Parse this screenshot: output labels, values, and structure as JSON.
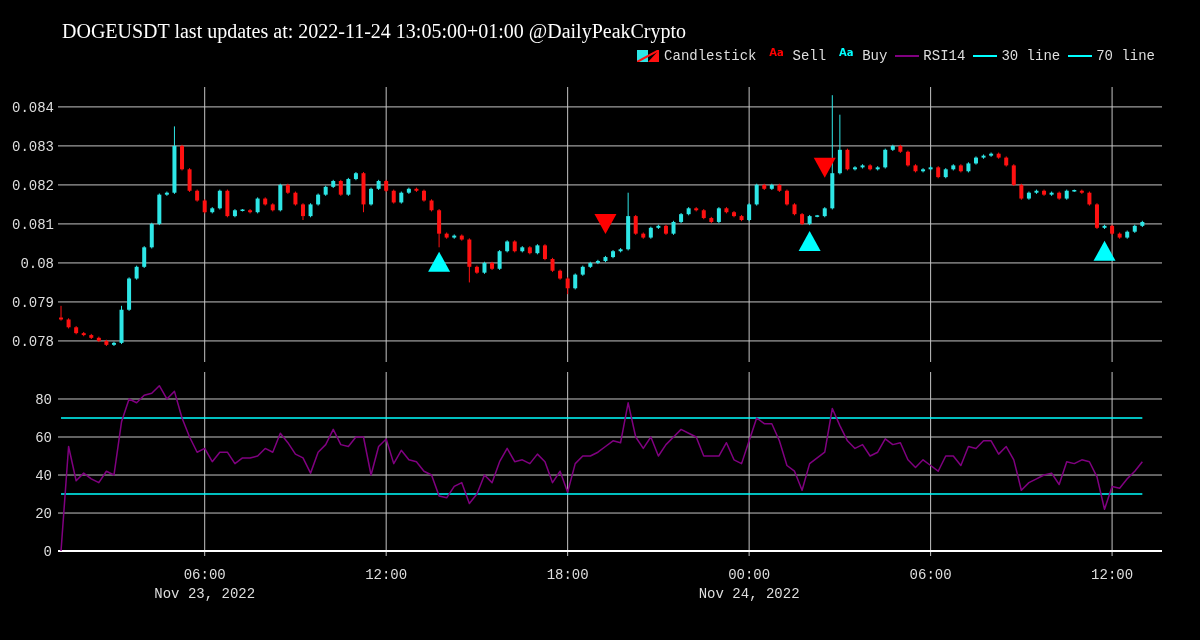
{
  "title": "DOGEUSDT last updates at: 2022-11-24 13:05:00+01:00 @DailyPeakCrypto",
  "legend": [
    {
      "label": "Candlestick",
      "kind": "candlestick"
    },
    {
      "label": "Sell",
      "kind": "text",
      "symbol": "Aa",
      "color": "#ff0000"
    },
    {
      "label": "Buy",
      "kind": "text",
      "symbol": "Aa",
      "color": "#00ffff"
    },
    {
      "label": "RSI14",
      "kind": "line",
      "color": "#800080"
    },
    {
      "label": "30 line",
      "kind": "line",
      "color": "#00ffff"
    },
    {
      "label": "70 line",
      "kind": "line",
      "color": "#00ffff"
    }
  ],
  "price_panel": {
    "chart_data": {
      "type": "candlestick",
      "grid": true,
      "x": [
        "2022-11-23 01:15",
        "2022-11-23 01:30",
        "2022-11-23 01:45",
        "2022-11-23 02:00",
        "2022-11-23 02:15",
        "2022-11-23 02:30",
        "2022-11-23 02:45",
        "2022-11-23 03:00",
        "2022-11-23 03:15",
        "2022-11-23 03:30",
        "2022-11-23 03:45",
        "2022-11-23 04:00",
        "2022-11-23 04:15",
        "2022-11-23 04:30",
        "2022-11-23 04:45",
        "2022-11-23 05:00",
        "2022-11-23 05:15",
        "2022-11-23 05:30",
        "2022-11-23 05:45",
        "2022-11-23 06:00",
        "2022-11-23 06:15",
        "2022-11-23 06:30",
        "2022-11-23 06:45",
        "2022-11-23 07:00",
        "2022-11-23 07:15",
        "2022-11-23 07:30",
        "2022-11-23 07:45",
        "2022-11-23 08:00",
        "2022-11-23 08:15",
        "2022-11-23 08:30",
        "2022-11-23 08:45",
        "2022-11-23 09:00",
        "2022-11-23 09:15",
        "2022-11-23 09:30",
        "2022-11-23 09:45",
        "2022-11-23 10:00",
        "2022-11-23 10:15",
        "2022-11-23 10:30",
        "2022-11-23 10:45",
        "2022-11-23 11:00",
        "2022-11-23 11:15",
        "2022-11-23 11:30",
        "2022-11-23 11:45",
        "2022-11-23 12:00",
        "2022-11-23 12:15",
        "2022-11-23 12:30",
        "2022-11-23 12:45",
        "2022-11-23 13:00",
        "2022-11-23 13:15",
        "2022-11-23 13:30",
        "2022-11-23 13:45",
        "2022-11-23 14:00",
        "2022-11-23 14:15",
        "2022-11-23 14:30",
        "2022-11-23 14:45",
        "2022-11-23 15:00",
        "2022-11-23 15:15",
        "2022-11-23 15:30",
        "2022-11-23 15:45",
        "2022-11-23 16:00",
        "2022-11-23 16:15",
        "2022-11-23 16:30",
        "2022-11-23 16:45",
        "2022-11-23 17:00",
        "2022-11-23 17:15",
        "2022-11-23 17:30",
        "2022-11-23 17:45",
        "2022-11-23 18:00",
        "2022-11-23 18:15",
        "2022-11-23 18:30",
        "2022-11-23 18:45",
        "2022-11-23 19:00",
        "2022-11-23 19:15",
        "2022-11-23 19:30",
        "2022-11-23 19:45",
        "2022-11-23 20:00",
        "2022-11-23 20:15",
        "2022-11-23 20:30",
        "2022-11-23 20:45",
        "2022-11-23 21:00",
        "2022-11-23 21:15",
        "2022-11-23 21:30",
        "2022-11-23 21:45",
        "2022-11-23 22:00",
        "2022-11-23 22:15",
        "2022-11-23 22:30",
        "2022-11-23 22:45",
        "2022-11-23 23:00",
        "2022-11-23 23:15",
        "2022-11-23 23:30",
        "2022-11-23 23:45",
        "2022-11-24 00:00",
        "2022-11-24 00:15",
        "2022-11-24 00:30",
        "2022-11-24 00:45",
        "2022-11-24 01:00",
        "2022-11-24 01:15",
        "2022-11-24 01:30",
        "2022-11-24 01:45",
        "2022-11-24 02:00",
        "2022-11-24 02:15",
        "2022-11-24 02:30",
        "2022-11-24 02:45",
        "2022-11-24 03:00",
        "2022-11-24 03:15",
        "2022-11-24 03:30",
        "2022-11-24 03:45",
        "2022-11-24 04:00",
        "2022-11-24 04:15",
        "2022-11-24 04:30",
        "2022-11-24 04:45",
        "2022-11-24 05:00",
        "2022-11-24 05:15",
        "2022-11-24 05:30",
        "2022-11-24 05:45",
        "2022-11-24 06:00",
        "2022-11-24 06:15",
        "2022-11-24 06:30",
        "2022-11-24 06:45",
        "2022-11-24 07:00",
        "2022-11-24 07:15",
        "2022-11-24 07:30",
        "2022-11-24 07:45",
        "2022-11-24 08:00",
        "2022-11-24 08:15",
        "2022-11-24 08:30",
        "2022-11-24 08:45",
        "2022-11-24 09:00",
        "2022-11-24 09:15",
        "2022-11-24 09:30",
        "2022-11-24 09:45",
        "2022-11-24 10:00",
        "2022-11-24 10:15",
        "2022-11-24 10:30",
        "2022-11-24 10:45",
        "2022-11-24 11:00",
        "2022-11-24 11:15",
        "2022-11-24 11:30",
        "2022-11-24 11:45",
        "2022-11-24 12:00",
        "2022-11-24 12:15",
        "2022-11-24 12:30",
        "2022-11-24 12:45",
        "2022-11-24 13:00"
      ],
      "xlim": [
        "2022-11-23 01:09",
        "2022-11-24 13:39"
      ],
      "ylim": [
        0.07746,
        0.08451
      ],
      "yticks": [
        {
          "value": 0.078,
          "label": "0.078"
        },
        {
          "value": 0.079,
          "label": "0.079"
        },
        {
          "value": 0.08,
          "label": "0.08"
        },
        {
          "value": 0.081,
          "label": "0.081"
        },
        {
          "value": 0.082,
          "label": "0.082"
        },
        {
          "value": 0.083,
          "label": "0.083"
        },
        {
          "value": 0.084,
          "label": "0.084"
        }
      ],
      "ohlc": [
        [
          0.0786,
          0.0789,
          0.07852,
          0.07855
        ],
        [
          0.07855,
          0.07858,
          0.07832,
          0.07835
        ],
        [
          0.07835,
          0.07838,
          0.07817,
          0.0782
        ],
        [
          0.0782,
          0.07823,
          0.07812,
          0.07815
        ],
        [
          0.07815,
          0.07818,
          0.07805,
          0.07808
        ],
        [
          0.07808,
          0.07811,
          0.07797,
          0.078
        ],
        [
          0.078,
          0.07803,
          0.07787,
          0.0779
        ],
        [
          0.0779,
          0.07798,
          0.07787,
          0.07795
        ],
        [
          0.07795,
          0.0789,
          0.07792,
          0.0788
        ],
        [
          0.0788,
          0.07963,
          0.07877,
          0.0796
        ],
        [
          0.0796,
          0.07993,
          0.07957,
          0.0799
        ],
        [
          0.0799,
          0.08043,
          0.07987,
          0.0804
        ],
        [
          0.0804,
          0.08103,
          0.08037,
          0.081
        ],
        [
          0.081,
          0.08178,
          0.08097,
          0.08175
        ],
        [
          0.08175,
          0.08183,
          0.08172,
          0.0818
        ],
        [
          0.0818,
          0.0835,
          0.08177,
          0.083
        ],
        [
          0.083,
          0.08303,
          0.08237,
          0.0824
        ],
        [
          0.0824,
          0.08243,
          0.08182,
          0.08185
        ],
        [
          0.08185,
          0.08188,
          0.08157,
          0.0816
        ],
        [
          0.0816,
          0.08163,
          0.08127,
          0.0813
        ],
        [
          0.0813,
          0.08143,
          0.08127,
          0.0814
        ],
        [
          0.0814,
          0.08188,
          0.08137,
          0.08185
        ],
        [
          0.08185,
          0.08188,
          0.08117,
          0.0812
        ],
        [
          0.0812,
          0.08138,
          0.08117,
          0.08135
        ],
        [
          0.08135,
          0.08138,
          0.08132,
          0.08135
        ],
        [
          0.08135,
          0.08138,
          0.08127,
          0.0813
        ],
        [
          0.0813,
          0.08168,
          0.08127,
          0.08165
        ],
        [
          0.08165,
          0.08168,
          0.08147,
          0.0815
        ],
        [
          0.0815,
          0.08153,
          0.08132,
          0.08135
        ],
        [
          0.08135,
          0.08203,
          0.08132,
          0.082
        ],
        [
          0.082,
          0.08203,
          0.08177,
          0.0818
        ],
        [
          0.0818,
          0.08183,
          0.08147,
          0.0815
        ],
        [
          0.0815,
          0.08153,
          0.0811,
          0.0812
        ],
        [
          0.0812,
          0.08153,
          0.08117,
          0.0815
        ],
        [
          0.0815,
          0.08178,
          0.08147,
          0.08175
        ],
        [
          0.08175,
          0.08198,
          0.08172,
          0.08195
        ],
        [
          0.08195,
          0.08213,
          0.08192,
          0.0821
        ],
        [
          0.0821,
          0.08213,
          0.08172,
          0.08175
        ],
        [
          0.08175,
          0.08218,
          0.08172,
          0.08215
        ],
        [
          0.08215,
          0.08233,
          0.08212,
          0.0823
        ],
        [
          0.0823,
          0.08233,
          0.0813,
          0.0815
        ],
        [
          0.0815,
          0.08193,
          0.08147,
          0.0819
        ],
        [
          0.0819,
          0.08213,
          0.08187,
          0.0821
        ],
        [
          0.0821,
          0.08213,
          0.08182,
          0.08185
        ],
        [
          0.08185,
          0.08188,
          0.08152,
          0.08155
        ],
        [
          0.08155,
          0.08183,
          0.08152,
          0.0818
        ],
        [
          0.0818,
          0.08193,
          0.08177,
          0.0819
        ],
        [
          0.0819,
          0.08193,
          0.08182,
          0.08185
        ],
        [
          0.08185,
          0.08188,
          0.08157,
          0.0816
        ],
        [
          0.0816,
          0.08163,
          0.08132,
          0.08135
        ],
        [
          0.08135,
          0.08138,
          0.0804,
          0.08075
        ],
        [
          0.08075,
          0.08078,
          0.08062,
          0.08065
        ],
        [
          0.08065,
          0.08073,
          0.08062,
          0.0807
        ],
        [
          0.0807,
          0.08073,
          0.08057,
          0.0806
        ],
        [
          0.0806,
          0.08063,
          0.0795,
          0.0799
        ],
        [
          0.0799,
          0.07993,
          0.07972,
          0.07975
        ],
        [
          0.07975,
          0.08003,
          0.07972,
          0.08
        ],
        [
          0.08,
          0.08003,
          0.07982,
          0.07985
        ],
        [
          0.07985,
          0.08033,
          0.07982,
          0.0803
        ],
        [
          0.0803,
          0.08058,
          0.08027,
          0.08055
        ],
        [
          0.08055,
          0.08058,
          0.08027,
          0.0803
        ],
        [
          0.0803,
          0.08043,
          0.08027,
          0.0804
        ],
        [
          0.0804,
          0.08043,
          0.08022,
          0.08025
        ],
        [
          0.08025,
          0.08048,
          0.08022,
          0.08045
        ],
        [
          0.08045,
          0.08048,
          0.08007,
          0.0801
        ],
        [
          0.0801,
          0.08013,
          0.07977,
          0.0798
        ],
        [
          0.0798,
          0.07983,
          0.07957,
          0.0796
        ],
        [
          0.0796,
          0.07963,
          0.0792,
          0.07935
        ],
        [
          0.07935,
          0.07973,
          0.07932,
          0.0797
        ],
        [
          0.0797,
          0.07993,
          0.07967,
          0.0799
        ],
        [
          0.0799,
          0.08003,
          0.07987,
          0.08
        ],
        [
          0.08,
          0.08008,
          0.07997,
          0.08005
        ],
        [
          0.08005,
          0.08018,
          0.08002,
          0.08015
        ],
        [
          0.08015,
          0.08033,
          0.08012,
          0.0803
        ],
        [
          0.0803,
          0.08038,
          0.08027,
          0.08035
        ],
        [
          0.08035,
          0.0818,
          0.08032,
          0.0812
        ],
        [
          0.0812,
          0.08123,
          0.08072,
          0.08075
        ],
        [
          0.08075,
          0.08078,
          0.08062,
          0.08065
        ],
        [
          0.08065,
          0.08093,
          0.08062,
          0.0809
        ],
        [
          0.0809,
          0.08098,
          0.08087,
          0.08095
        ],
        [
          0.08095,
          0.08098,
          0.08072,
          0.08075
        ],
        [
          0.08075,
          0.08108,
          0.08072,
          0.08105
        ],
        [
          0.08105,
          0.08128,
          0.08102,
          0.08125
        ],
        [
          0.08125,
          0.08143,
          0.08122,
          0.0814
        ],
        [
          0.0814,
          0.08143,
          0.08132,
          0.08135
        ],
        [
          0.08135,
          0.08138,
          0.08112,
          0.08115
        ],
        [
          0.08115,
          0.08118,
          0.08102,
          0.08105
        ],
        [
          0.08105,
          0.08143,
          0.08102,
          0.0814
        ],
        [
          0.0814,
          0.08143,
          0.08127,
          0.0813
        ],
        [
          0.0813,
          0.08133,
          0.08117,
          0.0812
        ],
        [
          0.0812,
          0.08123,
          0.08107,
          0.0811
        ],
        [
          0.0811,
          0.08153,
          0.08107,
          0.0815
        ],
        [
          0.0815,
          0.08203,
          0.08147,
          0.082
        ],
        [
          0.082,
          0.08203,
          0.08187,
          0.0819
        ],
        [
          0.0819,
          0.08203,
          0.08187,
          0.082
        ],
        [
          0.082,
          0.08203,
          0.08182,
          0.08185
        ],
        [
          0.08185,
          0.08188,
          0.08147,
          0.0815
        ],
        [
          0.0815,
          0.08153,
          0.08122,
          0.08125
        ],
        [
          0.08125,
          0.08128,
          0.08097,
          0.081
        ],
        [
          0.081,
          0.08123,
          0.08097,
          0.0812
        ],
        [
          0.0812,
          0.08123,
          0.08117,
          0.0812
        ],
        [
          0.0812,
          0.08143,
          0.08117,
          0.0814
        ],
        [
          0.0814,
          0.0843,
          0.08137,
          0.0823
        ],
        [
          0.0823,
          0.0838,
          0.08227,
          0.0829
        ],
        [
          0.0829,
          0.08293,
          0.08237,
          0.0824
        ],
        [
          0.0824,
          0.08248,
          0.08237,
          0.08245
        ],
        [
          0.08245,
          0.08253,
          0.08242,
          0.0825
        ],
        [
          0.0825,
          0.08253,
          0.08237,
          0.0824
        ],
        [
          0.0824,
          0.08248,
          0.08237,
          0.08245
        ],
        [
          0.08245,
          0.08293,
          0.08242,
          0.0829
        ],
        [
          0.0829,
          0.08303,
          0.08287,
          0.083
        ],
        [
          0.083,
          0.08303,
          0.08282,
          0.08285
        ],
        [
          0.08285,
          0.08288,
          0.08247,
          0.0825
        ],
        [
          0.0825,
          0.08253,
          0.08232,
          0.08235
        ],
        [
          0.08235,
          0.08243,
          0.08232,
          0.0824
        ],
        [
          0.0824,
          0.08248,
          0.08237,
          0.08245
        ],
        [
          0.08245,
          0.08248,
          0.08217,
          0.0822
        ],
        [
          0.0822,
          0.08243,
          0.08217,
          0.0824
        ],
        [
          0.0824,
          0.08253,
          0.08237,
          0.0825
        ],
        [
          0.0825,
          0.08253,
          0.08232,
          0.08235
        ],
        [
          0.08235,
          0.08258,
          0.08232,
          0.08255
        ],
        [
          0.08255,
          0.08273,
          0.08252,
          0.0827
        ],
        [
          0.0827,
          0.08278,
          0.08267,
          0.08275
        ],
        [
          0.08275,
          0.08283,
          0.08272,
          0.0828
        ],
        [
          0.0828,
          0.08283,
          0.08267,
          0.0827
        ],
        [
          0.0827,
          0.08273,
          0.08247,
          0.0825
        ],
        [
          0.0825,
          0.08253,
          0.08197,
          0.082
        ],
        [
          0.082,
          0.08203,
          0.08162,
          0.08165
        ],
        [
          0.08165,
          0.08183,
          0.08162,
          0.0818
        ],
        [
          0.0818,
          0.08188,
          0.08177,
          0.08185
        ],
        [
          0.08185,
          0.08188,
          0.08172,
          0.08175
        ],
        [
          0.08175,
          0.08183,
          0.08172,
          0.0818
        ],
        [
          0.0818,
          0.08183,
          0.08162,
          0.08165
        ],
        [
          0.08165,
          0.08188,
          0.08162,
          0.08185
        ],
        [
          0.08185,
          0.08188,
          0.08182,
          0.08185
        ],
        [
          0.08185,
          0.08188,
          0.08177,
          0.0818
        ],
        [
          0.0818,
          0.08183,
          0.08147,
          0.0815
        ],
        [
          0.0815,
          0.08153,
          0.08087,
          0.0809
        ],
        [
          0.0809,
          0.08098,
          0.08087,
          0.08095
        ],
        [
          0.08095,
          0.08098,
          0.08072,
          0.08075
        ],
        [
          0.08075,
          0.08078,
          0.08062,
          0.08065
        ],
        [
          0.08065,
          0.08083,
          0.08062,
          0.0808
        ],
        [
          0.0808,
          0.08098,
          0.08077,
          0.08095
        ],
        [
          0.08095,
          0.08108,
          0.08092,
          0.08105
        ]
      ],
      "series": [
        {
          "type": "scatter",
          "marker": "triangle-down",
          "color": "#ff0000",
          "values": [
            null,
            null,
            null,
            null,
            null,
            null,
            null,
            null,
            null,
            null,
            null,
            null,
            null,
            null,
            null,
            null,
            null,
            null,
            null,
            null,
            null,
            null,
            null,
            null,
            null,
            null,
            null,
            null,
            null,
            null,
            null,
            null,
            null,
            null,
            null,
            null,
            null,
            null,
            null,
            null,
            null,
            null,
            null,
            null,
            null,
            null,
            null,
            null,
            null,
            null,
            null,
            null,
            null,
            null,
            null,
            null,
            null,
            null,
            null,
            null,
            null,
            null,
            null,
            null,
            null,
            null,
            null,
            null,
            null,
            null,
            null,
            null,
            0.081,
            null,
            null,
            null,
            null,
            null,
            null,
            null,
            null,
            null,
            null,
            null,
            null,
            null,
            null,
            null,
            null,
            null,
            null,
            null,
            null,
            null,
            null,
            null,
            null,
            null,
            null,
            null,
            null,
            0.08244,
            null,
            null,
            null,
            null,
            null,
            null,
            null,
            null,
            null,
            null,
            null,
            null,
            null,
            null,
            null,
            null,
            null,
            null,
            null,
            null,
            null,
            null,
            null,
            null,
            null,
            null,
            null,
            null,
            null,
            null,
            null,
            null,
            null,
            null,
            null,
            null,
            null,
            null,
            null,
            null,
            null,
            null
          ]
        },
        {
          "type": "scatter",
          "marker": "triangle-up",
          "color": "#00ffff",
          "values": [
            null,
            null,
            null,
            null,
            null,
            null,
            null,
            null,
            null,
            null,
            null,
            null,
            null,
            null,
            null,
            null,
            null,
            null,
            null,
            null,
            null,
            null,
            null,
            null,
            null,
            null,
            null,
            null,
            null,
            null,
            null,
            null,
            null,
            null,
            null,
            null,
            null,
            null,
            null,
            null,
            null,
            null,
            null,
            null,
            null,
            null,
            null,
            null,
            null,
            null,
            0.08003,
            null,
            null,
            null,
            null,
            null,
            null,
            null,
            null,
            null,
            null,
            null,
            null,
            null,
            null,
            null,
            null,
            null,
            null,
            null,
            null,
            null,
            null,
            null,
            null,
            null,
            null,
            null,
            null,
            null,
            null,
            null,
            null,
            null,
            null,
            null,
            null,
            null,
            null,
            null,
            null,
            null,
            null,
            null,
            null,
            null,
            null,
            null,
            null,
            0.08056,
            null,
            null,
            null,
            null,
            null,
            null,
            null,
            null,
            null,
            null,
            null,
            null,
            null,
            null,
            null,
            null,
            null,
            null,
            null,
            null,
            null,
            null,
            null,
            null,
            null,
            null,
            null,
            null,
            null,
            null,
            null,
            null,
            null,
            null,
            null,
            null,
            null,
            null,
            0.08031,
            null,
            null,
            null,
            null,
            null
          ]
        }
      ]
    }
  },
  "rsi_panel": {
    "chart_data": {
      "type": "line",
      "grid": true,
      "x": [
        "2022-11-23 01:15",
        "2022-11-23 01:30",
        "2022-11-23 01:45",
        "2022-11-23 02:00",
        "2022-11-23 02:15",
        "2022-11-23 02:30",
        "2022-11-23 02:45",
        "2022-11-23 03:00",
        "2022-11-23 03:15",
        "2022-11-23 03:30",
        "2022-11-23 03:45",
        "2022-11-23 04:00",
        "2022-11-23 04:15",
        "2022-11-23 04:30",
        "2022-11-23 04:45",
        "2022-11-23 05:00",
        "2022-11-23 05:15",
        "2022-11-23 05:30",
        "2022-11-23 05:45",
        "2022-11-23 06:00",
        "2022-11-23 06:15",
        "2022-11-23 06:30",
        "2022-11-23 06:45",
        "2022-11-23 07:00",
        "2022-11-23 07:15",
        "2022-11-23 07:30",
        "2022-11-23 07:45",
        "2022-11-23 08:00",
        "2022-11-23 08:15",
        "2022-11-23 08:30",
        "2022-11-23 08:45",
        "2022-11-23 09:00",
        "2022-11-23 09:15",
        "2022-11-23 09:30",
        "2022-11-23 09:45",
        "2022-11-23 10:00",
        "2022-11-23 10:15",
        "2022-11-23 10:30",
        "2022-11-23 10:45",
        "2022-11-23 11:00",
        "2022-11-23 11:15",
        "2022-11-23 11:30",
        "2022-11-23 11:45",
        "2022-11-23 12:00",
        "2022-11-23 12:15",
        "2022-11-23 12:30",
        "2022-11-23 12:45",
        "2022-11-23 13:00",
        "2022-11-23 13:15",
        "2022-11-23 13:30",
        "2022-11-23 13:45",
        "2022-11-23 14:00",
        "2022-11-23 14:15",
        "2022-11-23 14:30",
        "2022-11-23 14:45",
        "2022-11-23 15:00",
        "2022-11-23 15:15",
        "2022-11-23 15:30",
        "2022-11-23 15:45",
        "2022-11-23 16:00",
        "2022-11-23 16:15",
        "2022-11-23 16:30",
        "2022-11-23 16:45",
        "2022-11-23 17:00",
        "2022-11-23 17:15",
        "2022-11-23 17:30",
        "2022-11-23 17:45",
        "2022-11-23 18:00",
        "2022-11-23 18:15",
        "2022-11-23 18:30",
        "2022-11-23 18:45",
        "2022-11-23 19:00",
        "2022-11-23 19:15",
        "2022-11-23 19:30",
        "2022-11-23 19:45",
        "2022-11-23 20:00",
        "2022-11-23 20:15",
        "2022-11-23 20:30",
        "2022-11-23 20:45",
        "2022-11-23 21:00",
        "2022-11-23 21:15",
        "2022-11-23 21:30",
        "2022-11-23 21:45",
        "2022-11-23 22:00",
        "2022-11-23 22:15",
        "2022-11-23 22:30",
        "2022-11-23 22:45",
        "2022-11-23 23:00",
        "2022-11-23 23:15",
        "2022-11-23 23:30",
        "2022-11-23 23:45",
        "2022-11-24 00:00",
        "2022-11-24 00:15",
        "2022-11-24 00:30",
        "2022-11-24 00:45",
        "2022-11-24 01:00",
        "2022-11-24 01:15",
        "2022-11-24 01:30",
        "2022-11-24 01:45",
        "2022-11-24 02:00",
        "2022-11-24 02:15",
        "2022-11-24 02:30",
        "2022-11-24 02:45",
        "2022-11-24 03:00",
        "2022-11-24 03:15",
        "2022-11-24 03:30",
        "2022-11-24 03:45",
        "2022-11-24 04:00",
        "2022-11-24 04:15",
        "2022-11-24 04:30",
        "2022-11-24 04:45",
        "2022-11-24 05:00",
        "2022-11-24 05:15",
        "2022-11-24 05:30",
        "2022-11-24 05:45",
        "2022-11-24 06:00",
        "2022-11-24 06:15",
        "2022-11-24 06:30",
        "2022-11-24 06:45",
        "2022-11-24 07:00",
        "2022-11-24 07:15",
        "2022-11-24 07:30",
        "2022-11-24 07:45",
        "2022-11-24 08:00",
        "2022-11-24 08:15",
        "2022-11-24 08:30",
        "2022-11-24 08:45",
        "2022-11-24 09:00",
        "2022-11-24 09:15",
        "2022-11-24 09:30",
        "2022-11-24 09:45",
        "2022-11-24 10:00",
        "2022-11-24 10:15",
        "2022-11-24 10:30",
        "2022-11-24 10:45",
        "2022-11-24 11:00",
        "2022-11-24 11:15",
        "2022-11-24 11:30",
        "2022-11-24 11:45",
        "2022-11-24 12:00",
        "2022-11-24 12:15",
        "2022-11-24 12:30",
        "2022-11-24 12:45",
        "2022-11-24 13:00"
      ],
      "xlim": [
        "2022-11-23 01:09",
        "2022-11-24 13:39"
      ],
      "ylim": [
        -2.6,
        94.2
      ],
      "xticks": [
        {
          "value": "2022-11-23 06:00",
          "label": "06:00\nNov 23, 2022"
        },
        {
          "value": "2022-11-23 12:00",
          "label": "12:00"
        },
        {
          "value": "2022-11-23 18:00",
          "label": "18:00"
        },
        {
          "value": "2022-11-24 00:00",
          "label": "00:00\nNov 24, 2022"
        },
        {
          "value": "2022-11-24 06:00",
          "label": "06:00"
        },
        {
          "value": "2022-11-24 12:00",
          "label": "12:00"
        }
      ],
      "yticks": [
        0,
        20,
        40,
        60,
        80
      ],
      "series": [
        {
          "color": "#800080",
          "values": [
            0,
            55,
            37,
            41,
            38,
            36,
            42,
            40,
            68,
            80,
            78,
            82,
            83,
            87,
            80,
            84,
            70,
            60,
            52,
            54,
            47,
            52,
            52,
            46,
            49,
            49,
            50,
            54,
            52,
            62,
            57,
            51,
            49,
            41,
            52,
            56,
            64,
            56,
            55,
            60,
            60,
            40,
            55,
            59,
            46,
            53,
            48,
            47,
            42,
            40,
            29,
            28,
            34,
            36,
            25,
            30,
            40,
            36,
            47,
            54,
            47,
            48,
            46,
            51,
            47,
            36,
            42,
            31,
            46,
            50,
            50,
            52,
            55,
            58,
            57,
            78,
            60,
            54,
            60,
            50,
            56,
            60,
            64,
            62,
            60,
            50,
            50,
            50,
            57,
            48,
            46,
            58,
            70,
            67,
            67,
            58,
            45,
            42,
            32,
            46,
            49,
            52,
            75,
            66,
            58,
            54,
            56,
            50,
            52,
            59,
            56,
            57,
            48,
            44,
            48,
            45,
            42,
            50,
            50,
            45,
            55,
            54,
            58,
            58,
            51,
            55,
            48,
            32,
            36,
            38,
            40,
            41,
            35,
            47,
            46,
            48,
            47,
            39,
            22,
            34,
            33,
            38,
            42,
            47
          ]
        }
      ],
      "ref_lines": [
        {
          "axis": "y",
          "value": 30,
          "color": "#00ffff"
        },
        {
          "axis": "y",
          "value": 70,
          "color": "#00ffff"
        }
      ]
    }
  }
}
